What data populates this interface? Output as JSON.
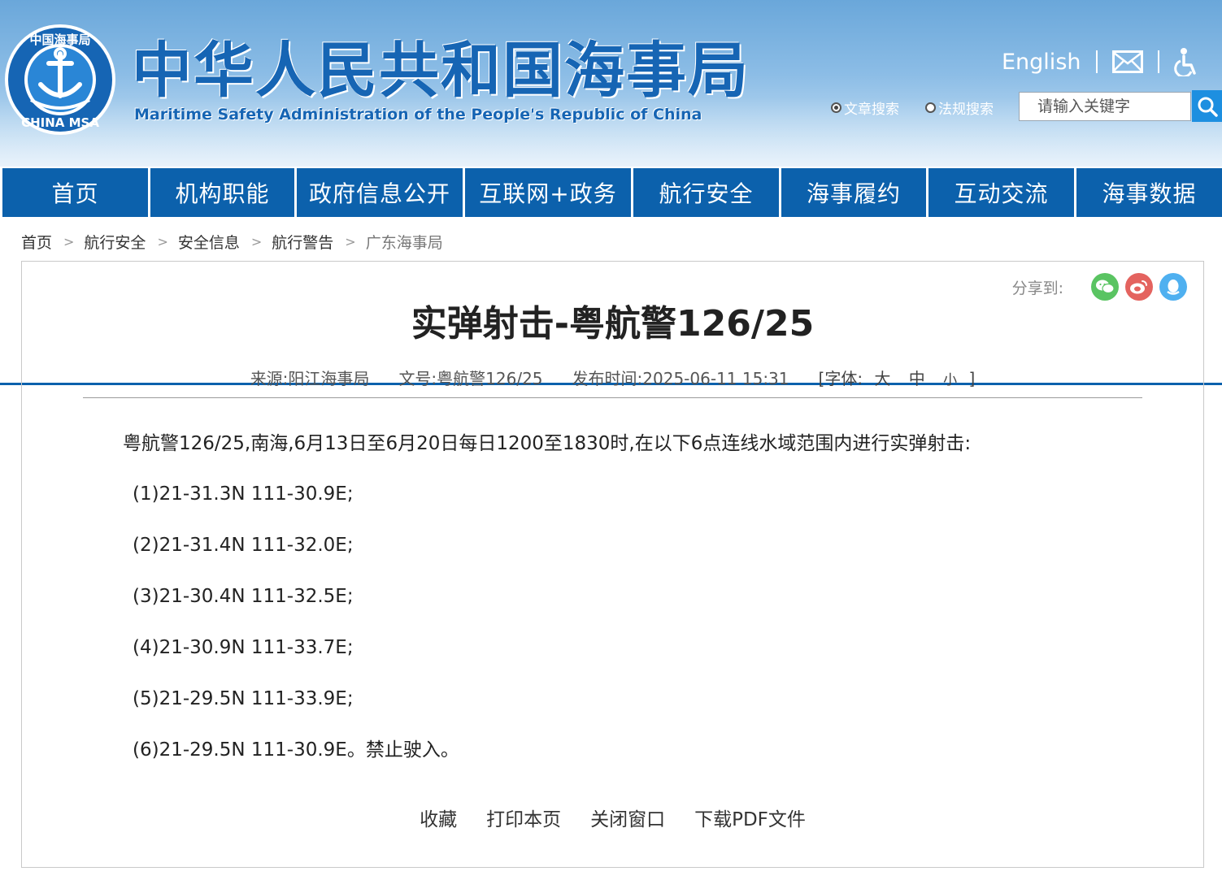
{
  "header": {
    "title_cn": "中华人民共和国海事局",
    "title_en": "Maritime Safety Administration of the People's Republic of China",
    "emblem_top_text": "中国海事局",
    "emblem_bottom_text": "CHINA MSA",
    "english_link": "English",
    "mail_icon": "mail-icon",
    "accessibility_icon": "accessibility-icon",
    "search_types": [
      {
        "label": "文章搜索",
        "checked": true
      },
      {
        "label": "法规搜索",
        "checked": false
      }
    ],
    "search_placeholder": "请输入关键字",
    "search_icon": "search-icon",
    "brand_color": "#1665b4"
  },
  "nav": {
    "color": "#0c61ac",
    "items": [
      "首页",
      "机构职能",
      "政府信息公开",
      "互联网+政务",
      "航行安全",
      "海事履约",
      "互动交流",
      "海事数据"
    ]
  },
  "breadcrumb": [
    "首页",
    "航行安全",
    "安全信息",
    "航行警告",
    "广东海事局"
  ],
  "share": {
    "label": "分享到:",
    "buttons": [
      {
        "name": "wechat-share-icon",
        "color": "#5ac462"
      },
      {
        "name": "weibo-share-icon",
        "color": "#e4635f"
      },
      {
        "name": "qq-share-icon",
        "color": "#4fb0f0"
      }
    ]
  },
  "article": {
    "title": "实弹射击-粤航警126/25",
    "source": "来源:阳江海事局",
    "doc_no": "文号:粤航警126/25",
    "published": "发布时间:2025-06-11 15:31",
    "font_label": "[字体:",
    "font_sizes": [
      "大",
      "中",
      "小"
    ],
    "font_close": "]",
    "lead": "粤航警126/25,南海,6月13日至6月20日每日1200至1830时,在以下6点连线水域范围内进行实弹射击:",
    "points": [
      "(1)21-31.3N 111-30.9E;",
      "(2)21-31.4N 111-32.0E;",
      "(3)21-30.4N 111-32.5E;",
      "(4)21-30.9N 111-33.7E;",
      "(5)21-29.5N 111-33.9E;",
      "(6)21-29.5N 111-30.9E。禁止驶入。"
    ]
  },
  "actions": [
    "收藏",
    "打印本页",
    "关闭窗口",
    "下载PDF文件"
  ]
}
